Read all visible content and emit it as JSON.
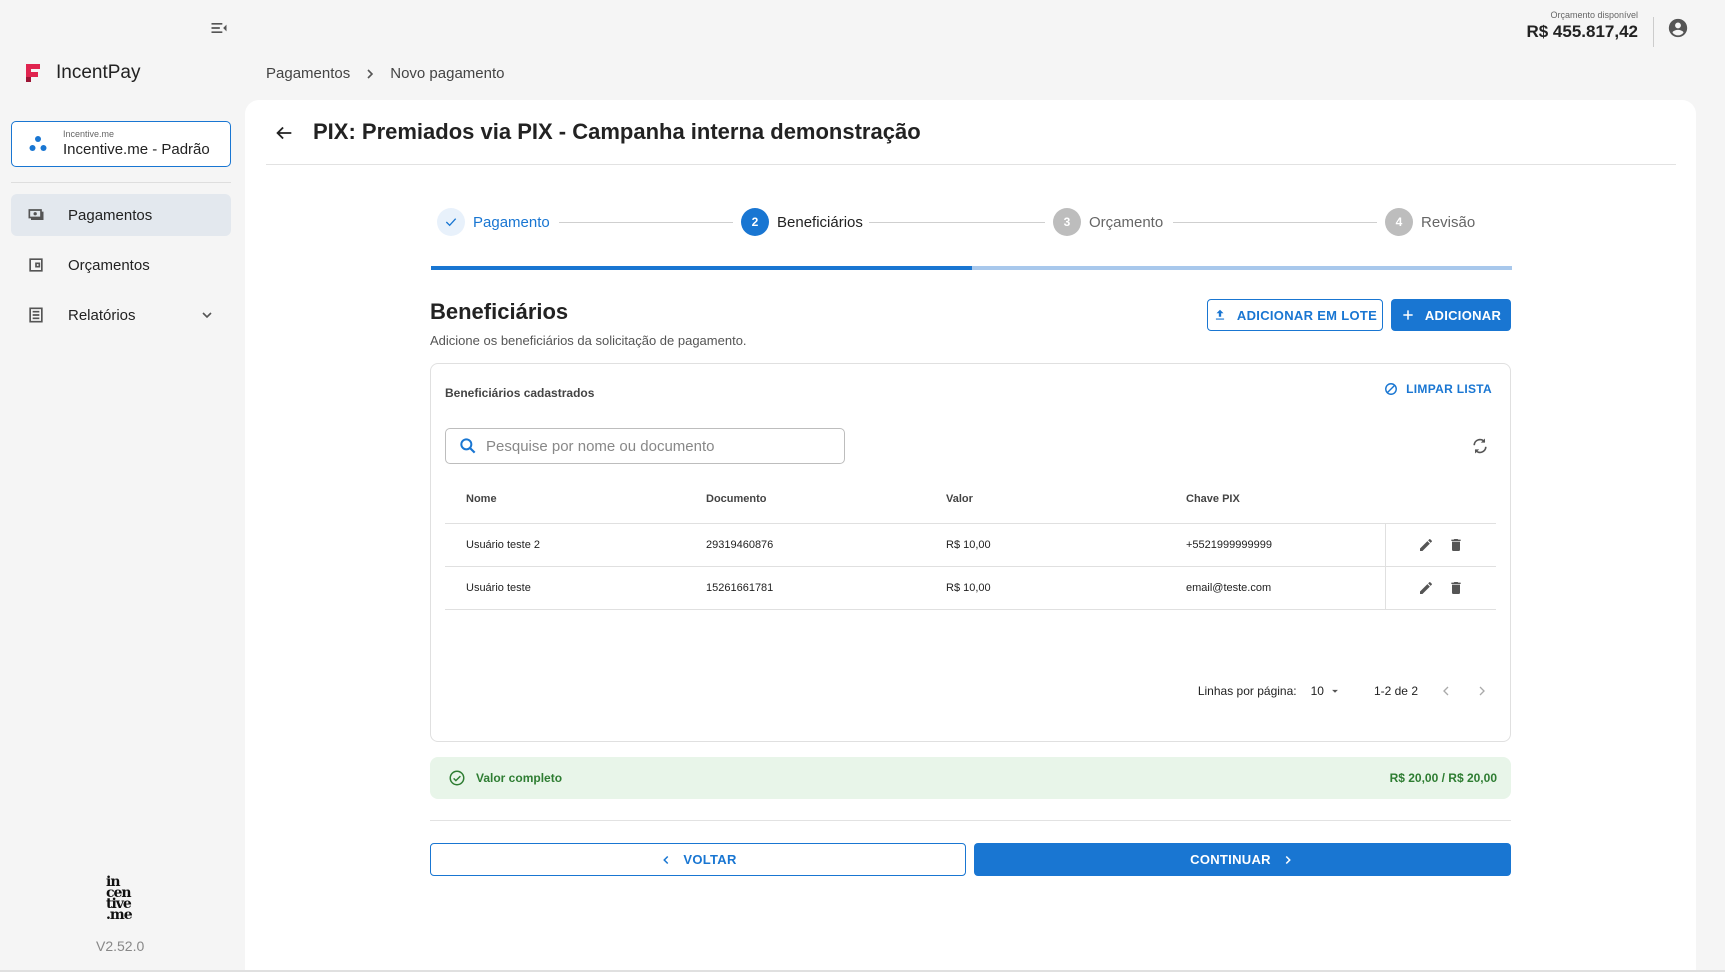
{
  "sidebar": {
    "brand": "IncentPay",
    "org": {
      "small": "Incentive.me",
      "name": "Incentive.me - Padrão"
    },
    "items": [
      {
        "label": "Pagamentos",
        "icon": "payments-icon",
        "active": true
      },
      {
        "label": "Orçamentos",
        "icon": "wallet-icon",
        "active": false
      },
      {
        "label": "Relatórios",
        "icon": "reports-icon",
        "active": false
      }
    ],
    "version": "V2.52.0"
  },
  "topbar": {
    "budget_label": "Orçamento disponível",
    "budget_value": "R$ 455.817,42"
  },
  "breadcrumb": [
    "Pagamentos",
    "Novo pagamento"
  ],
  "page": {
    "title": "PIX: Premiados via PIX - Campanha interna demonstração"
  },
  "stepper": {
    "steps": [
      {
        "number": "1",
        "label": "Pagamento",
        "state": "done"
      },
      {
        "number": "2",
        "label": "Beneficiários",
        "state": "active"
      },
      {
        "number": "3",
        "label": "Orçamento",
        "state": "todo"
      },
      {
        "number": "4",
        "label": "Revisão",
        "state": "todo"
      }
    ],
    "progress_percent": 50
  },
  "section": {
    "title": "Beneficiários",
    "subtitle": "Adicione os beneficiários da solicitação de pagamento.",
    "add_batch_label": "ADICIONAR EM LOTE",
    "add_label": "ADICIONAR"
  },
  "beneficiaries": {
    "title": "Beneficiários cadastrados",
    "clear_label": "LIMPAR LISTA",
    "search_placeholder": "Pesquise por nome ou documento",
    "columns": [
      "Nome",
      "Documento",
      "Valor",
      "Chave PIX"
    ],
    "rows": [
      {
        "name": "Usuário teste 2",
        "document": "29319460876",
        "value": "R$ 10,00",
        "pix": "+5521999999999"
      },
      {
        "name": "Usuário teste",
        "document": "15261661781",
        "value": "R$ 10,00",
        "pix": "email@teste.com"
      }
    ],
    "pagination": {
      "rows_per_page_label": "Linhas por página:",
      "rows_per_page": "10",
      "range": "1-2 de 2"
    }
  },
  "status": {
    "text": "Valor completo",
    "value": "R$ 20,00 / R$ 20,00"
  },
  "footer": {
    "back_label": "VOLTAR",
    "continue_label": "CONTINUAR"
  },
  "colors": {
    "primary": "#1976d2",
    "success": "#2e7d32",
    "success_bg": "#e8f5e9",
    "brand": "#e0244f"
  }
}
